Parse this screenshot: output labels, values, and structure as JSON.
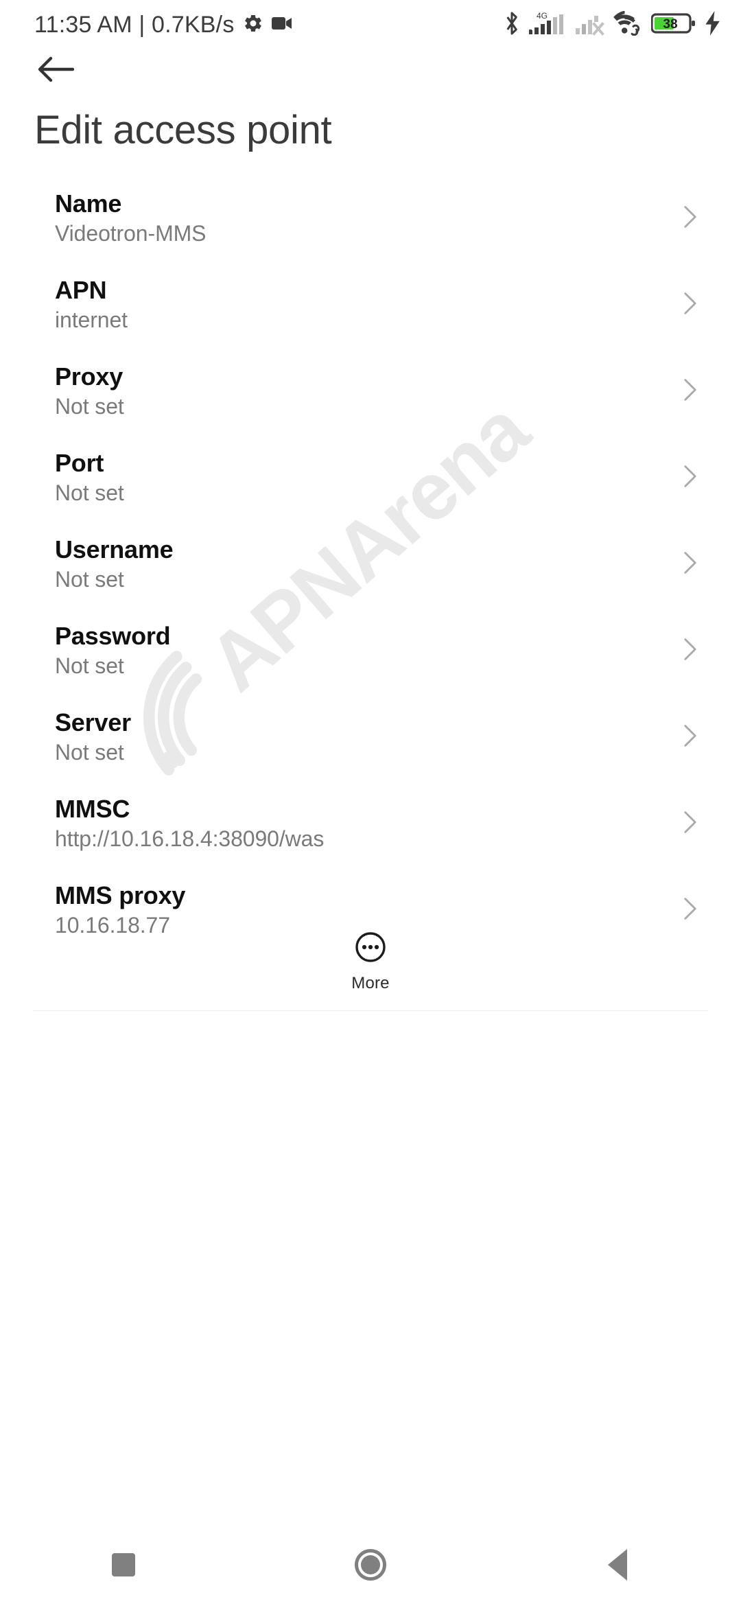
{
  "statusbar": {
    "clock_and_rate": "11:35 AM | 0.7KB/s",
    "gear_icon": "gear-icon",
    "camcorder_icon": "camcorder-icon",
    "bluetooth_icon": "bluetooth-icon",
    "network_type": "4G",
    "sim1_signal_icon": "signal-bars-icon",
    "sim2_signal_icon": "signal-bars-no-service-icon",
    "wifi_icon": "wifi-icon",
    "battery_level": "38",
    "battery_color": "#4CD137",
    "charging_icon": "charging-bolt-icon"
  },
  "topbar": {
    "back_icon": "back-arrow-icon",
    "title": "Edit access point"
  },
  "watermark": {
    "text": "APNArena",
    "icon": "wifi-icon",
    "color": "#e9e9e9"
  },
  "rows": [
    {
      "title": "Name",
      "value": "Videotron-MMS"
    },
    {
      "title": "APN",
      "value": "internet"
    },
    {
      "title": "Proxy",
      "value": "Not set"
    },
    {
      "title": "Port",
      "value": "Not set"
    },
    {
      "title": "Username",
      "value": "Not set"
    },
    {
      "title": "Password",
      "value": "Not set"
    },
    {
      "title": "Server",
      "value": "Not set"
    },
    {
      "title": "MMSC",
      "value": "http://10.16.18.4:38090/was"
    },
    {
      "title": "MMS proxy",
      "value": "10.16.18.77"
    }
  ],
  "more": {
    "label": "More",
    "icon": "more-dots-circle-icon"
  },
  "navbar": {
    "recents_icon": "recents-square-icon",
    "home_icon": "home-circle-icon",
    "back_icon": "back-triangle-icon"
  }
}
